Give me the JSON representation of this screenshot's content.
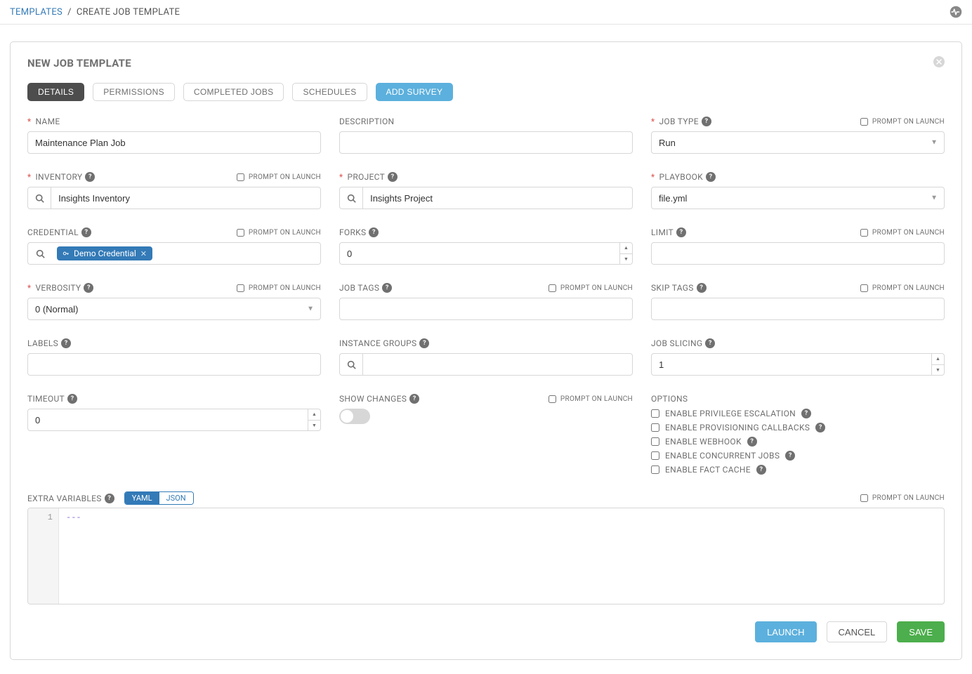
{
  "breadcrumb": {
    "root": "TEMPLATES",
    "current": "CREATE JOB TEMPLATE"
  },
  "panel": {
    "title": "NEW JOB TEMPLATE"
  },
  "tabs": {
    "details": "DETAILS",
    "permissions": "PERMISSIONS",
    "completed_jobs": "COMPLETED JOBS",
    "schedules": "SCHEDULES",
    "add_survey": "ADD SURVEY"
  },
  "labels": {
    "name": "NAME",
    "description": "DESCRIPTION",
    "job_type": "JOB TYPE",
    "inventory": "INVENTORY",
    "project": "PROJECT",
    "playbook": "PLAYBOOK",
    "credential": "CREDENTIAL",
    "forks": "FORKS",
    "limit": "LIMIT",
    "verbosity": "VERBOSITY",
    "job_tags": "JOB TAGS",
    "skip_tags": "SKIP TAGS",
    "labels_lbl": "LABELS",
    "instance_groups": "INSTANCE GROUPS",
    "job_slicing": "JOB SLICING",
    "timeout": "TIMEOUT",
    "show_changes": "SHOW CHANGES",
    "options": "OPTIONS",
    "extra_variables": "EXTRA VARIABLES",
    "prompt_on_launch": "PROMPT ON LAUNCH"
  },
  "values": {
    "name": "Maintenance Plan Job",
    "description": "",
    "job_type": "Run",
    "inventory": "Insights Inventory",
    "project": "Insights Project",
    "playbook": "file.yml",
    "credential_chip": "Demo Credential",
    "forks": "0",
    "limit": "",
    "verbosity": "0 (Normal)",
    "job_tags": "",
    "skip_tags": "",
    "labels_val": "",
    "instance_groups": "",
    "job_slicing": "1",
    "timeout": "0",
    "extra_vars_line": "---"
  },
  "options_list": {
    "privilege_escalation": "ENABLE PRIVILEGE ESCALATION",
    "provisioning_callbacks": "ENABLE PROVISIONING CALLBACKS",
    "webhook": "ENABLE WEBHOOK",
    "concurrent_jobs": "ENABLE CONCURRENT JOBS",
    "fact_cache": "ENABLE FACT CACHE"
  },
  "format_toggle": {
    "yaml": "YAML",
    "json": "JSON"
  },
  "buttons": {
    "launch": "LAUNCH",
    "cancel": "CANCEL",
    "save": "SAVE"
  },
  "editor": {
    "line1_num": "1"
  }
}
